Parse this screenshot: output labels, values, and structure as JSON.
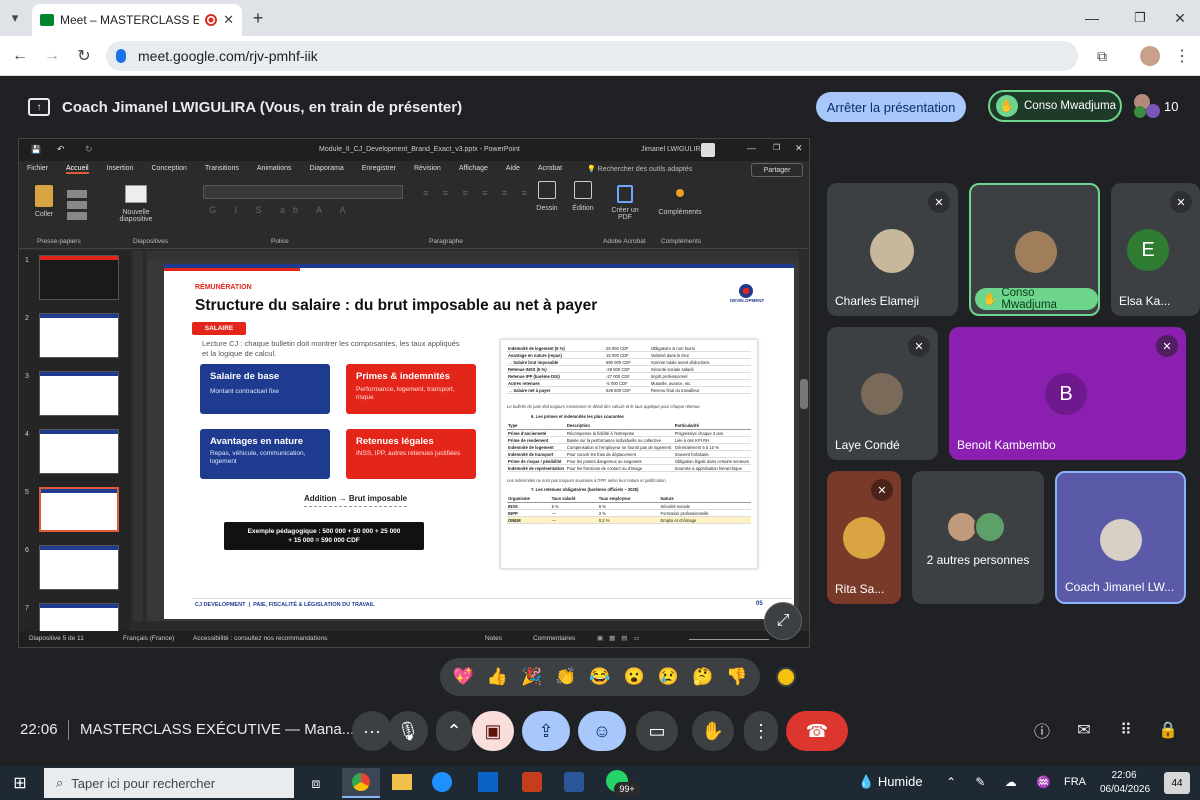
{
  "browser": {
    "tab_title": "Meet – MASTERCLASS EXÉC",
    "url": "meet.google.com/rjv-pmhf-iik"
  },
  "meet": {
    "presenter_banner": "Coach Jimanel LWIGULIRA (Vous, en train de présenter)",
    "stop_presenting": "Arrêter la présentation",
    "pinned_user": "Conso Mwadjuma",
    "participant_count": "10",
    "participants": [
      {
        "name": "Charles Elameji"
      },
      {
        "name": "Conso Mwadjuma"
      },
      {
        "name": "Elsa Ka...",
        "initial": "E"
      },
      {
        "name": "Laye Condé"
      },
      {
        "name": "Benoit Kambembo",
        "initial": "B"
      },
      {
        "name": "Rita Sa..."
      },
      {
        "name": "2 autres personnes"
      },
      {
        "name": "Coach Jimanel LW..."
      }
    ],
    "time": "22:06",
    "meeting_title": "MASTERCLASS EXÉCUTIVE — Mana..."
  },
  "ppt": {
    "file_title": "Module_II_CJ_Development_Brand_Exact_v3.pptx  -  PowerPoint",
    "user": "Jimanel LWIGULIRA",
    "tabs": [
      "Fichier",
      "Accueil",
      "Insertion",
      "Conception",
      "Transitions",
      "Animations",
      "Diaporama",
      "Enregistrer",
      "Révision",
      "Affichage",
      "Aide",
      "Acrobat"
    ],
    "search": "Rechercher des outils adaptés",
    "share": "Partager",
    "groups": [
      "Presse-papiers",
      "Diapositives",
      "Police",
      "Paragraphe",
      "Adobe Acrobat",
      "Compléments"
    ],
    "buttons": {
      "paste": "Coller",
      "new_slide": "Nouvelle diapositive",
      "design": "Dessin",
      "edit": "Édition",
      "create_pdf": "Créer un PDF",
      "addins": "Compléments"
    },
    "slide_numbers": [
      "1",
      "2",
      "3",
      "4",
      "5",
      "6",
      "7"
    ],
    "status_slide": "Diapositive 5 de 11",
    "status_lang": "Français (France)",
    "status_access": "Accessibilité : consultez nos recommandations",
    "status_notes": "Notes",
    "status_comments": "Commentaires"
  },
  "slide": {
    "kicker": "RÉMUNÉRATION",
    "title": "Structure du salaire : du brut imposable au net à payer",
    "tag": "SALAIRE",
    "logo": "DEVELOPMENT",
    "intro": "Lecture CJ : chaque bulletin doit montrer les composantes, les taux appliqués et la logique de calcul.",
    "cards": [
      {
        "title": "Salaire de base",
        "text": "Montant contractuel fixe"
      },
      {
        "title": "Primes & indemnités",
        "text": "Performance, logement, transport, risque"
      },
      {
        "title": "Avantages en nature",
        "text": "Repas, véhicule, communication, logement"
      },
      {
        "title": "Retenues légales",
        "text": "INSS, IPP, autres retenues justifiées"
      }
    ],
    "addition": "Addition → Brut imposable",
    "example_line1": "Exemple pédagogique : 500 000 + 50 000 + 25 000",
    "example_line2": "+ 15 000 = 590 000 CDF",
    "footer_left": "CJ DEVELOPMENT",
    "footer_right": "PAIE, FISCALITÉ & LÉGISLATION DU TRAVAIL",
    "page_no": "05",
    "doc": {
      "top_rows": [
        [
          "Indemnité de logement (5 %)",
          "25 000 CDF",
          "Obligatoire si non fourni"
        ],
        [
          "Avantage en nature (repas)",
          "15 000 CDF",
          "Valorisé dans le brut"
        ],
        [
          "→ Salaire brut imposable",
          "590 000 CDF",
          "Somme totale avant déductions"
        ],
        [
          "Retenue INSS (5 %)",
          "-29 500 CDF",
          "Sécurité sociale salarié"
        ],
        [
          "Retenue IPP (barème DGI)",
          "-27 000 CDF",
          "Impôt professionnel"
        ],
        [
          "Autres retenues",
          "-5 000 CDF",
          "Mutuelle, avance, etc."
        ],
        [
          "→ Salaire net à payer",
          "528 500 CDF",
          "Revenu final du travailleur"
        ]
      ],
      "note": "Le bulletin de paie doit toujours mentionner le détail des calculs et le taux appliqué pour chaque retenue.",
      "section6": "6.  Les primes et indemnités les plus courantes",
      "primes_headers": [
        "Type",
        "Description",
        "Particularité"
      ],
      "primes_rows": [
        [
          "Prime d'ancienneté",
          "Récompense la fidélité à l'entreprise",
          "Progressive chaque 3 ans"
        ],
        [
          "Prime de rendement",
          "Basée sur la performance individuelle ou collective",
          "Liée à des KPI RH"
        ],
        [
          "Indemnité de logement",
          "Compensation si l'employeur ne fournit pas de logement",
          "Généralement 5 à 10 %"
        ],
        [
          "Indemnité de transport",
          "Pour couvrir les frais de déplacement",
          "Souvent forfaitaire"
        ],
        [
          "Prime de risque / pénibilité",
          "Pour les postes dangereux ou exigeants",
          "Obligation légale dans certains secteurs"
        ],
        [
          "Indemnité de représentation",
          "Pour les fonctions de contact ou d'image",
          "Soumise à approbation hiérarchique"
        ]
      ],
      "note2": "Les indemnités ne sont pas toujours soumises à l'IPP, selon leur nature et justification.",
      "section7": "7.  Les retenues obligatoires (barèmes officiels – 2025)",
      "ret_headers": [
        "Organisme",
        "Taux salarié",
        "Taux employeur",
        "Nature"
      ],
      "ret_rows": [
        [
          "INSS",
          "5 %",
          "9 %",
          "Sécurité sociale"
        ],
        [
          "INPP",
          "—",
          "3 %",
          "Formation professionnelle"
        ],
        [
          "ONEM",
          "—",
          "0,2 %",
          "Emploi et chômage"
        ]
      ]
    }
  },
  "reactions": [
    "💖",
    "👍",
    "🎉",
    "👏",
    "😂",
    "😮",
    "😢",
    "🤔",
    "👎"
  ],
  "taskbar": {
    "search": "Taper ici pour rechercher",
    "weather": "Humide",
    "lang": "FRA",
    "time": "22:06",
    "date": "06/04/2026",
    "notifications": "44",
    "whatsapp_badge": "99+"
  },
  "colors": {
    "navy": "#1f3b8f",
    "red": "#e32619",
    "meet_green": "#6dd58c",
    "stop_blue": "#a8c7fa",
    "end_red": "#dc362e"
  }
}
